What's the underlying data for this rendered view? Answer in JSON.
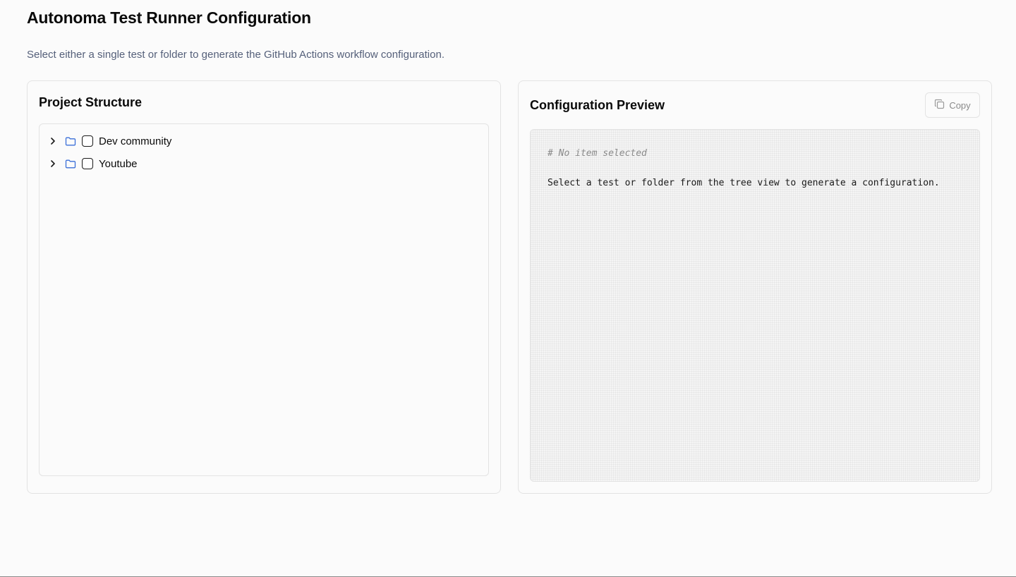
{
  "header": {
    "title": "Autonoma Test Runner Configuration",
    "subtitle": "Select either a single test or folder to generate the GitHub Actions workflow configuration."
  },
  "project_structure": {
    "title": "Project Structure",
    "items": [
      {
        "label": "Dev community",
        "icon": "folder-icon",
        "expanded": false,
        "checked": false
      },
      {
        "label": "Youtube",
        "icon": "folder-icon",
        "expanded": false,
        "checked": false
      }
    ]
  },
  "preview": {
    "title": "Configuration Preview",
    "copy_label": "Copy",
    "comment": "# No item selected",
    "message": "Select a test or folder from the tree view to generate a configuration."
  },
  "colors": {
    "folder_icon": "#3b6fd8",
    "subtitle": "#55607a",
    "border": "#e3e3e3"
  }
}
